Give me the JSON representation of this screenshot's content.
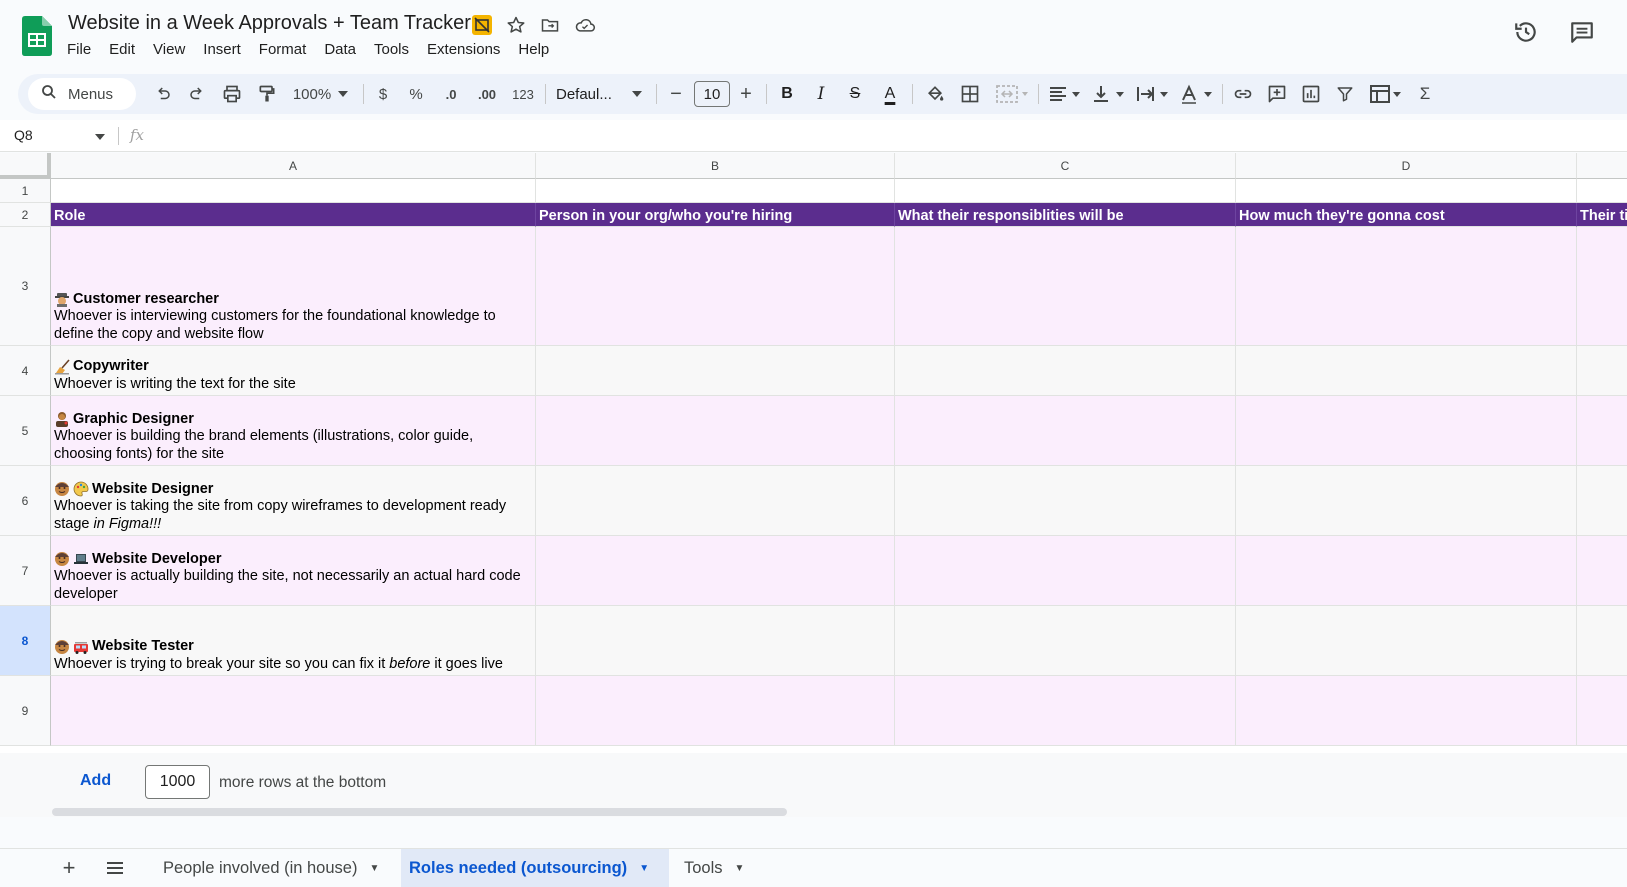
{
  "app": {
    "doc_title": "Website in a Week Approvals + Team Tracker",
    "menu": [
      "File",
      "Edit",
      "View",
      "Insert",
      "Format",
      "Data",
      "Tools",
      "Extensions",
      "Help"
    ]
  },
  "toolbar": {
    "search_label": "Menus",
    "zoom": "100%",
    "currency": "$",
    "percent": "%",
    "decrease_decimal": ".0",
    "increase_decimal": ".00",
    "number_format": "123",
    "font": "Defaul...",
    "font_size": "10",
    "minus": "−",
    "plus": "+",
    "bold": "B",
    "italic": "I",
    "strike": "S",
    "text_color": "A",
    "sigma": "Σ"
  },
  "formula_bar": {
    "cell_ref": "Q8",
    "fx": "fx"
  },
  "grid": {
    "columns": [
      "A",
      "B",
      "C",
      "D"
    ],
    "rows": [
      "1",
      "2",
      "3",
      "4",
      "5",
      "6",
      "7",
      "8",
      "9"
    ],
    "headers": {
      "role": "Role",
      "person": "Person in your org/who you're hiring",
      "responsibilities": "What their responsiblities will be",
      "cost": "How much they're gonna cost",
      "timeline_partial": "Their ti"
    },
    "roles": [
      {
        "title": "Customer researcher",
        "desc": "Whoever is interviewing customers for the foundational knowledge to define the copy and website flow"
      },
      {
        "title": "Copywriter",
        "desc": "Whoever is writing the text for the site"
      },
      {
        "title": "Graphic Designer",
        "desc": "Whoever is building the brand elements (illustrations, color guide, choosing fonts) for the site"
      },
      {
        "title": "Website Designer",
        "desc": "Whoever is taking the site from copy wireframes to development ready stage ",
        "desc_em": "in Figma!!!"
      },
      {
        "title": "Website Developer",
        "desc": "Whoever is actually building the site, not necessarily an actual hard code developer"
      },
      {
        "title": "Website Tester",
        "desc": "Whoever is trying to break your site so you can fix it ",
        "desc_em": "before",
        "desc_tail": " it goes live"
      }
    ],
    "header_color": "#5b2d8e",
    "pink_row_color": "#fbeefd"
  },
  "add_rows": {
    "button": "Add",
    "count": "1000",
    "suffix": "more rows at the bottom"
  },
  "tabs": {
    "add": "+",
    "list": "≡",
    "items": [
      "People involved (in house)",
      "Roles needed (outsourcing)",
      "Tools"
    ],
    "active": "Roles needed (outsourcing)"
  },
  "icons": [
    "sheets-logo",
    "slides-badge-icon",
    "star-icon",
    "move-folder-icon",
    "cloud-icon",
    "history-icon",
    "comments-icon",
    "search-icon",
    "undo-icon",
    "redo-icon",
    "print-icon",
    "paint-format-icon",
    "fill-color-icon",
    "borders-icon",
    "merge-icon",
    "align-icon",
    "valign-icon",
    "wrap-icon",
    "rotate-icon",
    "link-icon",
    "comment-icon",
    "chart-icon",
    "filter-icon",
    "filter-views-icon",
    "functions-icon"
  ]
}
